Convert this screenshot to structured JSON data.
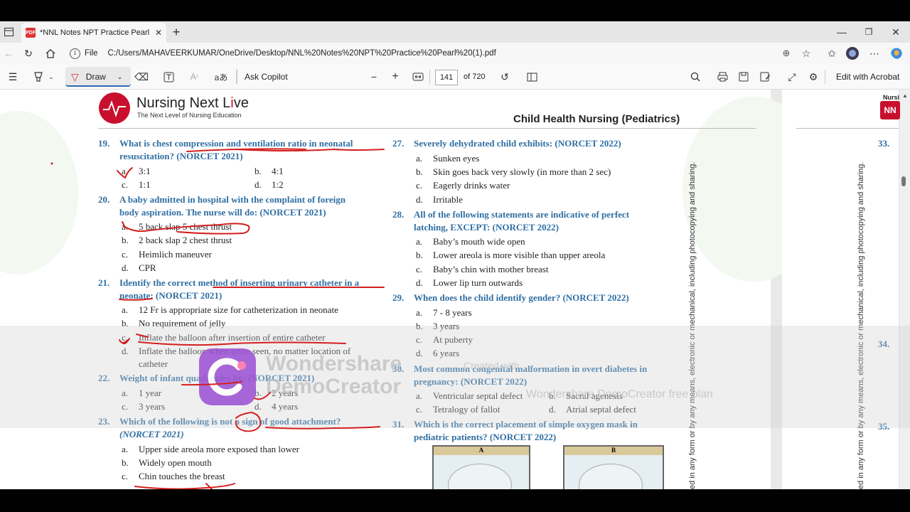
{
  "browser": {
    "tab_title": "*NNL Notes NPT Practice Pearl (1",
    "pdf_badge": "PDF",
    "file_label": "File",
    "url": "C:/Users/MAHAVEERKUMAR/OneDrive/Desktop/NNL%20Notes%20NPT%20Practice%20Pearl%20(1).pdf"
  },
  "pdf_toolbar": {
    "draw_label": "Draw",
    "text_icon": "aあ",
    "ask_copilot": "Ask Copilot",
    "page_current": "141",
    "page_total": "of 720",
    "edit_acrobat": "Edit with Acrobat"
  },
  "page": {
    "brand_pre": "Nursing Next L",
    "brand_post": "ve",
    "tagline": "The Next Level of Nursing Education",
    "chapter": "Child Health Nursing (Pediatrics)",
    "side_text": "ed in any form or by any means, electronic or mechanical, including photocopying and sharing.",
    "right_brand": "Nursi",
    "right_badge": "NN",
    "right_numbers": [
      "33.",
      "34.",
      "35."
    ]
  },
  "questions_left": [
    {
      "num": "19.",
      "line1": "What is chest compression and ventilation ratio in neonatal",
      "line2": "resuscitation? (NORCET 2021)",
      "options": [
        [
          "a.",
          "3:1"
        ],
        [
          "b.",
          "4:1"
        ],
        [
          "c.",
          "1:1"
        ],
        [
          "d.",
          "1:2"
        ]
      ]
    },
    {
      "num": "20.",
      "line1": "A baby admitted in hospital with the complaint of foreign",
      "line2": "body aspiration. The nurse will do:  (NORCET 2021)",
      "options": [
        [
          "a.",
          "5 back slap 5 chest thrust"
        ],
        [
          "b.",
          "2 back slap 2 chest thrust"
        ],
        [
          "c.",
          "Heimlich maneuver"
        ],
        [
          "d.",
          "CPR"
        ]
      ]
    },
    {
      "num": "21.",
      "line1": "Identify the correct method of inserting urinary catheter in a",
      "line2": "neonate: (NORCET 2021)",
      "options": [
        [
          "a.",
          "12 Fr is appropriate size for catheterization in neonate"
        ],
        [
          "b.",
          "No requirement of jelly"
        ],
        [
          "c.",
          "Inflate the balloon after insertion of entire catheter"
        ],
        [
          "d.",
          "Inflate the balloon when urine seen, no matter location of"
        ]
      ],
      "extra": "catheter"
    },
    {
      "num": "22.",
      "line1": "Weight of infant quadruples by: (NORCET 2021)",
      "options": [
        [
          "a.",
          "1 year"
        ],
        [
          "b.",
          "2 years"
        ],
        [
          "c.",
          "3 years"
        ],
        [
          "d.",
          "4 years"
        ]
      ]
    },
    {
      "num": "23.",
      "line1": "Which of the following is not a sign of good attachment?",
      "line2": "(NORCET 2021)",
      "options": [
        [
          "a.",
          "Upper side areola more exposed than lower"
        ],
        [
          "b.",
          "Widely open mouth"
        ],
        [
          "c.",
          "Chin touches the breast"
        ]
      ]
    }
  ],
  "questions_right": [
    {
      "num": "27.",
      "line1": "Severely dehydrated child exhibits: (NORCET 2022)",
      "options": [
        [
          "a.",
          "Sunken eyes"
        ],
        [
          "b.",
          "Skin goes back very slowly (in more than 2 sec)"
        ],
        [
          "c.",
          "Eagerly drinks water"
        ],
        [
          "d.",
          "Irritable"
        ]
      ]
    },
    {
      "num": "28.",
      "line1": "All of the following statements are indicative of perfect",
      "line2": "latching, EXCEPT: (NORCET 2022)",
      "options": [
        [
          "a.",
          "Baby’s mouth wide open"
        ],
        [
          "b.",
          "Lower areola is more visible than upper areola"
        ],
        [
          "c.",
          "Baby’s chin with mother breast"
        ],
        [
          "d.",
          "Lower lip turn outwards"
        ]
      ]
    },
    {
      "num": "29.",
      "line1": "When does the child identify gender? (NORCET 2022)",
      "options": [
        [
          "a.",
          "7 - 8 years"
        ],
        [
          "b.",
          "3 years"
        ],
        [
          "c.",
          "At puberty"
        ],
        [
          "d.",
          "6 years"
        ]
      ]
    },
    {
      "num": "30.",
      "line1": "Most common congenital malformation in overt diabetes in",
      "line2": "pregnancy: (NORCET 2022)",
      "options": [
        [
          "a.",
          "Ventricular septal defect"
        ],
        [
          "b.",
          "Sacral agenesis"
        ],
        [
          "c.",
          "Tetralogy of fallot"
        ],
        [
          "d.",
          "Atrial septal defect"
        ]
      ]
    },
    {
      "num": "31.",
      "line1": "Which is the correct placement of simple oxygen mask in",
      "line2": "pediatric patients? (NORCET 2022)",
      "figures": [
        "A",
        "B"
      ]
    }
  ],
  "watermark": {
    "line1": "Wondershare",
    "line2": "DemoCreator",
    "created_with": "Created with",
    "free_plan": "Wondershare DemoCreator free plan"
  }
}
